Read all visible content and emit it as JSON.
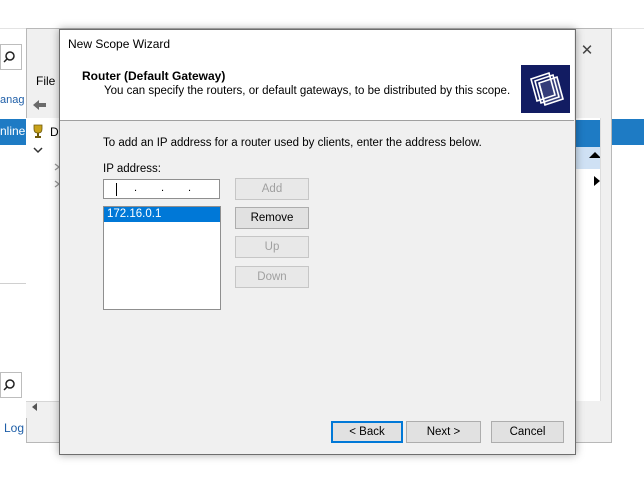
{
  "background": {
    "manage_link": "anag",
    "online_label": "nline",
    "log_link": "Log"
  },
  "console": {
    "file_menu": "File",
    "tree_label": "D",
    "close_glyph": "✕"
  },
  "wizard": {
    "window_title": "New Scope Wizard",
    "header_title": "Router (Default Gateway)",
    "header_description": "You can specify the routers, or default gateways, to be distributed by this scope.",
    "instruction": "To add an IP address for a router used by clients, enter the address below.",
    "ip_label": "IP address:",
    "ip_value": "",
    "routers": [
      "172.16.0.1"
    ],
    "buttons": {
      "add": "Add",
      "remove": "Remove",
      "up": "Up",
      "down": "Down"
    },
    "footer": {
      "back": "< Back",
      "next": "Next >",
      "cancel": "Cancel"
    }
  },
  "colors": {
    "selection": "#0078d7",
    "header_icon_bg": "#121c62",
    "bg_band": "#1e7bc4"
  }
}
